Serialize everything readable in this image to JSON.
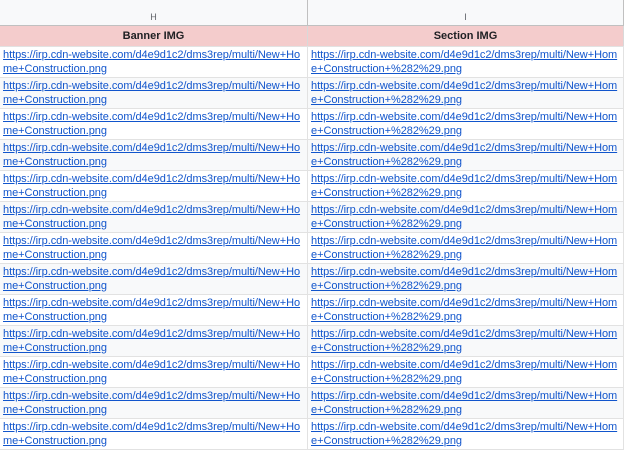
{
  "columns": {
    "h_letter": "H",
    "i_letter": "I"
  },
  "header": {
    "banner_img": "Banner IMG",
    "section_img": "Section IMG"
  },
  "colors": {
    "header_bg": "#f4cccc",
    "link": "#1155cc"
  },
  "rows": [
    {
      "banner": "https://irp.cdn-website.com/d4e9d1c2/dms3rep/multi/New+Home+Construction.png",
      "section": "https://irp.cdn-website.com/d4e9d1c2/dms3rep/multi/New+Home+Construction+%282%29.png"
    },
    {
      "banner": "https://irp.cdn-website.com/d4e9d1c2/dms3rep/multi/New+Home+Construction.png",
      "section": "https://irp.cdn-website.com/d4e9d1c2/dms3rep/multi/New+Home+Construction+%282%29.png"
    },
    {
      "banner": "https://irp.cdn-website.com/d4e9d1c2/dms3rep/multi/New+Home+Construction.png",
      "section": "https://irp.cdn-website.com/d4e9d1c2/dms3rep/multi/New+Home+Construction+%282%29.png"
    },
    {
      "banner": "https://irp.cdn-website.com/d4e9d1c2/dms3rep/multi/New+Home+Construction.png",
      "section": "https://irp.cdn-website.com/d4e9d1c2/dms3rep/multi/New+Home+Construction+%282%29.png"
    },
    {
      "banner": "https://irp.cdn-website.com/d4e9d1c2/dms3rep/multi/New+Home+Construction.png",
      "section": "https://irp.cdn-website.com/d4e9d1c2/dms3rep/multi/New+Home+Construction+%282%29.png"
    },
    {
      "banner": "https://irp.cdn-website.com/d4e9d1c2/dms3rep/multi/New+Home+Construction.png",
      "section": "https://irp.cdn-website.com/d4e9d1c2/dms3rep/multi/New+Home+Construction+%282%29.png"
    },
    {
      "banner": "https://irp.cdn-website.com/d4e9d1c2/dms3rep/multi/New+Home+Construction.png",
      "section": "https://irp.cdn-website.com/d4e9d1c2/dms3rep/multi/New+Home+Construction+%282%29.png"
    },
    {
      "banner": "https://irp.cdn-website.com/d4e9d1c2/dms3rep/multi/New+Home+Construction.png",
      "section": "https://irp.cdn-website.com/d4e9d1c2/dms3rep/multi/New+Home+Construction+%282%29.png"
    },
    {
      "banner": "https://irp.cdn-website.com/d4e9d1c2/dms3rep/multi/New+Home+Construction.png",
      "section": "https://irp.cdn-website.com/d4e9d1c2/dms3rep/multi/New+Home+Construction+%282%29.png"
    },
    {
      "banner": "https://irp.cdn-website.com/d4e9d1c2/dms3rep/multi/New+Home+Construction.png",
      "section": "https://irp.cdn-website.com/d4e9d1c2/dms3rep/multi/New+Home+Construction+%282%29.png"
    },
    {
      "banner": "https://irp.cdn-website.com/d4e9d1c2/dms3rep/multi/New+Home+Construction.png",
      "section": "https://irp.cdn-website.com/d4e9d1c2/dms3rep/multi/New+Home+Construction+%282%29.png"
    },
    {
      "banner": "https://irp.cdn-website.com/d4e9d1c2/dms3rep/multi/New+Home+Construction.png",
      "section": "https://irp.cdn-website.com/d4e9d1c2/dms3rep/multi/New+Home+Construction+%282%29.png"
    },
    {
      "banner": "https://irp.cdn-website.com/d4e9d1c2/dms3rep/multi/New+Home+Construction.png",
      "section": "https://irp.cdn-website.com/d4e9d1c2/dms3rep/multi/New+Home+Construction+%282%29.png"
    }
  ]
}
